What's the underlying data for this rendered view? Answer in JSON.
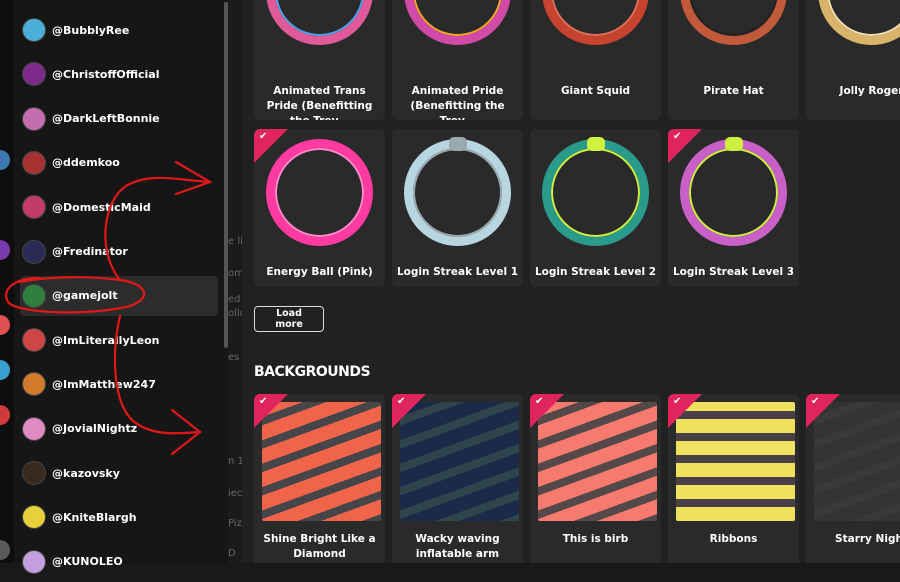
{
  "accounts": [
    {
      "name": "@BubblyRee",
      "color": "#4ab0d9"
    },
    {
      "name": "@ChristoffOfficial",
      "color": "#7d2a8c"
    },
    {
      "name": "@DarkLeftBonnie",
      "color": "#c46db0"
    },
    {
      "name": "@ddemkoo",
      "color": "#a83232"
    },
    {
      "name": "@DomesticMaid",
      "color": "#c23b6b"
    },
    {
      "name": "@Fredinator",
      "color": "#2a2a55"
    },
    {
      "name": "@gamejolt",
      "color": "#2f7f3f"
    },
    {
      "name": "@ImLiterallyLeon",
      "color": "#d04545"
    },
    {
      "name": "@ImMatthew247",
      "color": "#d27a2c"
    },
    {
      "name": "@JovialNightz",
      "color": "#e08ac4"
    },
    {
      "name": "@kazovsky",
      "color": "#3a2a1e"
    },
    {
      "name": "@KniteBlargh",
      "color": "#e8d03a"
    },
    {
      "name": "@KUNOLEO",
      "color": "#c2a0e0"
    }
  ],
  "active_account": "@gamejolt",
  "midpage_fragments": [
    "e li",
    "om",
    "ed",
    "ollo",
    "es",
    "n 1",
    "iec",
    "Pizz",
    "D"
  ],
  "frames_row1": [
    {
      "label": "Animated Trans Pride (Benefitting the Trev…",
      "ring": "#e05a9a",
      "accent": "#4aa3e8"
    },
    {
      "label": "Animated Pride (Benefitting the Trev…",
      "ring": "#d14aa8",
      "accent": "#f5a623"
    },
    {
      "label": "Giant Squid",
      "ring": "#c8432e",
      "accent": "#e0705a"
    },
    {
      "label": "Pirate Hat",
      "ring": "#c05a3a",
      "accent": "#222222"
    },
    {
      "label": "Jolly Roger",
      "ring": "#d9b36a",
      "accent": "#f0e0b0"
    }
  ],
  "frames_row2": [
    {
      "label": "Energy Ball (Pink)",
      "ring": "#ff3aa0",
      "accent": "#ff8ad0",
      "owned": true
    },
    {
      "label": "Login Streak Level 1",
      "ring": "#b8d6e0",
      "accent": "#9aa9b0",
      "owned": false
    },
    {
      "label": "Login Streak Level 2",
      "ring": "#2a9a8a",
      "accent": "#d0f040",
      "owned": false
    },
    {
      "label": "Login Streak Level 3",
      "ring": "#c860c8",
      "accent": "#d0f040",
      "owned": true
    }
  ],
  "load_more_label": "Load more",
  "backgrounds_heading": "BACKGROUNDS",
  "backgrounds": [
    {
      "label": "Shine Bright Like a Diamond",
      "color": "#f0644a",
      "accent": "#b0b0c8"
    },
    {
      "label": "Wacky waving inflatable arm flailing…",
      "color": "#1c2a4a",
      "accent": "#3ab0d0"
    },
    {
      "label": "This is birb",
      "color": "#f77a6e",
      "accent": "#ffc0c0"
    },
    {
      "label": "Ribbons",
      "color": "#f0e060",
      "accent": "#c89ac0"
    },
    {
      "label": "Starry Night",
      "color": "#333333",
      "accent": "#777777"
    }
  ],
  "checkmark": "✔",
  "colors": {
    "ribbon": "#e0245e",
    "annotation": "#e01818"
  }
}
